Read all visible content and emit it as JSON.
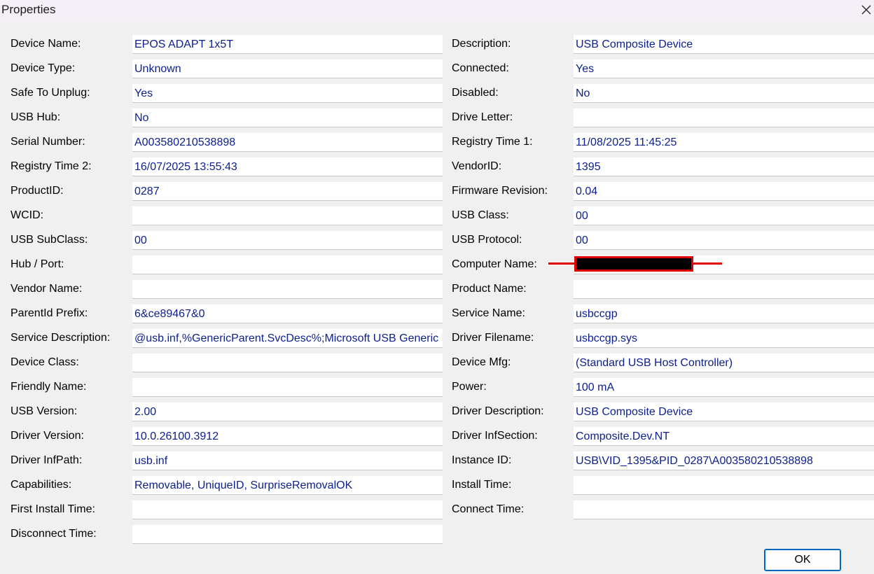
{
  "window": {
    "title": "Properties",
    "close_icon": "close-icon"
  },
  "left_fields": [
    {
      "label": "Device Name:",
      "value": "EPOS ADAPT 1x5T"
    },
    {
      "label": "Device Type:",
      "value": "Unknown"
    },
    {
      "label": "Safe To Unplug:",
      "value": "Yes"
    },
    {
      "label": "USB Hub:",
      "value": "No"
    },
    {
      "label": "Serial Number:",
      "value": "A003580210538898"
    },
    {
      "label": "Registry Time 2:",
      "value": "16/07/2025 13:55:43"
    },
    {
      "label": "ProductID:",
      "value": "0287"
    },
    {
      "label": "WCID:",
      "value": ""
    },
    {
      "label": "USB SubClass:",
      "value": "00"
    },
    {
      "label": "Hub / Port:",
      "value": ""
    },
    {
      "label": "Vendor Name:",
      "value": ""
    },
    {
      "label": "ParentId Prefix:",
      "value": "6&ce89467&0"
    },
    {
      "label": "Service Description:",
      "value": "@usb.inf,%GenericParent.SvcDesc%;Microsoft USB Generic Parent Driver"
    },
    {
      "label": "Device Class:",
      "value": ""
    },
    {
      "label": "Friendly Name:",
      "value": ""
    },
    {
      "label": "USB Version:",
      "value": "2.00"
    },
    {
      "label": "Driver Version:",
      "value": "10.0.26100.3912"
    },
    {
      "label": "Driver InfPath:",
      "value": "usb.inf"
    },
    {
      "label": "Capabilities:",
      "value": "Removable, UniqueID, SurpriseRemovalOK"
    },
    {
      "label": "First Install Time:",
      "value": ""
    },
    {
      "label": "Disconnect Time:",
      "value": ""
    }
  ],
  "right_fields": [
    {
      "label": "Description:",
      "value": "USB Composite Device"
    },
    {
      "label": "Connected:",
      "value": "Yes"
    },
    {
      "label": "Disabled:",
      "value": "No"
    },
    {
      "label": "Drive Letter:",
      "value": ""
    },
    {
      "label": "Registry Time 1:",
      "value": "11/08/2025 11:45:25"
    },
    {
      "label": "VendorID:",
      "value": "1395"
    },
    {
      "label": "Firmware Revision:",
      "value": "0.04"
    },
    {
      "label": "USB Class:",
      "value": "00"
    },
    {
      "label": "USB Protocol:",
      "value": "00"
    },
    {
      "label": "Computer Name:",
      "value": "",
      "redacted": true
    },
    {
      "label": "Product Name:",
      "value": ""
    },
    {
      "label": "Service Name:",
      "value": "usbccgp"
    },
    {
      "label": "Driver Filename:",
      "value": "usbccgp.sys"
    },
    {
      "label": "Device Mfg:",
      "value": "(Standard USB Host Controller)"
    },
    {
      "label": "Power:",
      "value": "100 mA"
    },
    {
      "label": "Driver Description:",
      "value": "USB Composite Device"
    },
    {
      "label": "Driver InfSection:",
      "value": "Composite.Dev.NT"
    },
    {
      "label": "Instance ID:",
      "value": "USB\\VID_1395&PID_0287\\A003580210538898"
    },
    {
      "label": "Install Time:",
      "value": ""
    },
    {
      "label": "Connect Time:",
      "value": ""
    }
  ],
  "buttons": {
    "ok_label": "OK"
  },
  "colors": {
    "value_text": "#0b1f8f",
    "redaction_mark": "#e00000"
  }
}
